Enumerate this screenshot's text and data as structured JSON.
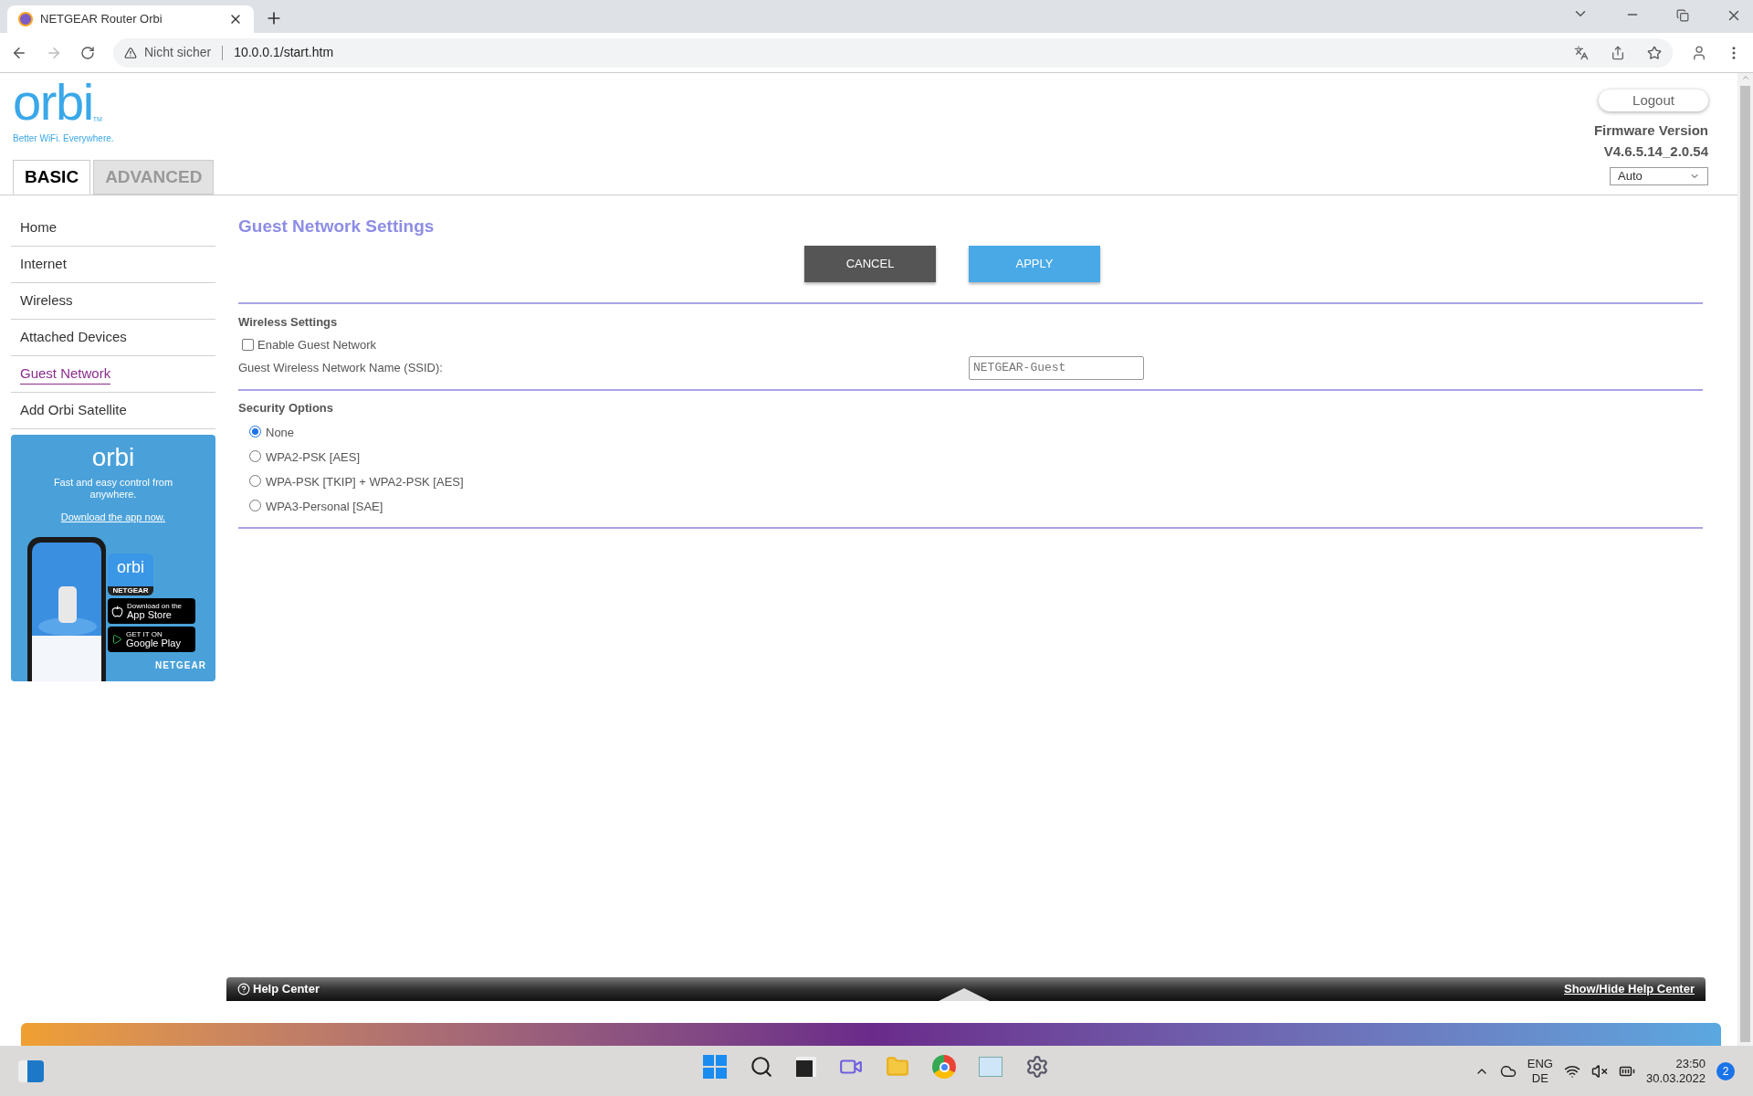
{
  "browser": {
    "tab_title": "NETGEAR Router Orbi",
    "security": "Nicht sicher",
    "url": "10.0.0.1/start.htm"
  },
  "header": {
    "logo": "orbi",
    "logo_mark": "TM",
    "tagline": "Better WiFi. Everywhere.",
    "logout": "Logout",
    "firmware_label": "Firmware Version",
    "firmware_version": "V4.6.5.14_2.0.54",
    "language": "Auto",
    "tabs": [
      {
        "label": "BASIC",
        "selected": true
      },
      {
        "label": "ADVANCED",
        "selected": false
      }
    ]
  },
  "sidebar": {
    "items": [
      {
        "label": "Home",
        "selected": false
      },
      {
        "label": "Internet",
        "selected": false
      },
      {
        "label": "Wireless",
        "selected": false
      },
      {
        "label": "Attached Devices",
        "selected": false
      },
      {
        "label": "Guest Network",
        "selected": true
      },
      {
        "label": "Add Orbi Satellite",
        "selected": false
      }
    ]
  },
  "promo": {
    "logo": "orbi",
    "text": "Fast and easy control from anywhere.",
    "link": "Download the app now.",
    "app_icon_logo": "orbi",
    "app_icon_brand": "NETGEAR",
    "app_store_small": "Download on the",
    "app_store": "App Store",
    "google_small": "GET IT ON",
    "google": "Google Play",
    "brand": "NETGEAR"
  },
  "content": {
    "title": "Guest Network Settings",
    "buttons": [
      {
        "kind": "cancel",
        "label": "CANCEL"
      },
      {
        "kind": "apply",
        "label": "APPLY"
      }
    ],
    "wireless_title": "Wireless Settings",
    "enable_guest": {
      "label": "Enable Guest Network",
      "checked": false
    },
    "ssid": {
      "label": "Guest Wireless Network Name (SSID):",
      "value": "NETGEAR-Guest"
    },
    "security_title": "Security Options",
    "security_options": [
      {
        "label": "None",
        "selected": true
      },
      {
        "label": "WPA2-PSK [AES]",
        "selected": false
      },
      {
        "label": "WPA-PSK [TKIP] + WPA2-PSK [AES]",
        "selected": false
      },
      {
        "label": "WPA3-Personal [SAE]",
        "selected": false
      }
    ]
  },
  "help_bar": {
    "title": "Help Center",
    "toggle": "Show/Hide Help Center"
  },
  "taskbar": {
    "language": "ENG",
    "region": "DE",
    "time": "23:50",
    "date": "30.03.2022",
    "notifications": "2"
  }
}
